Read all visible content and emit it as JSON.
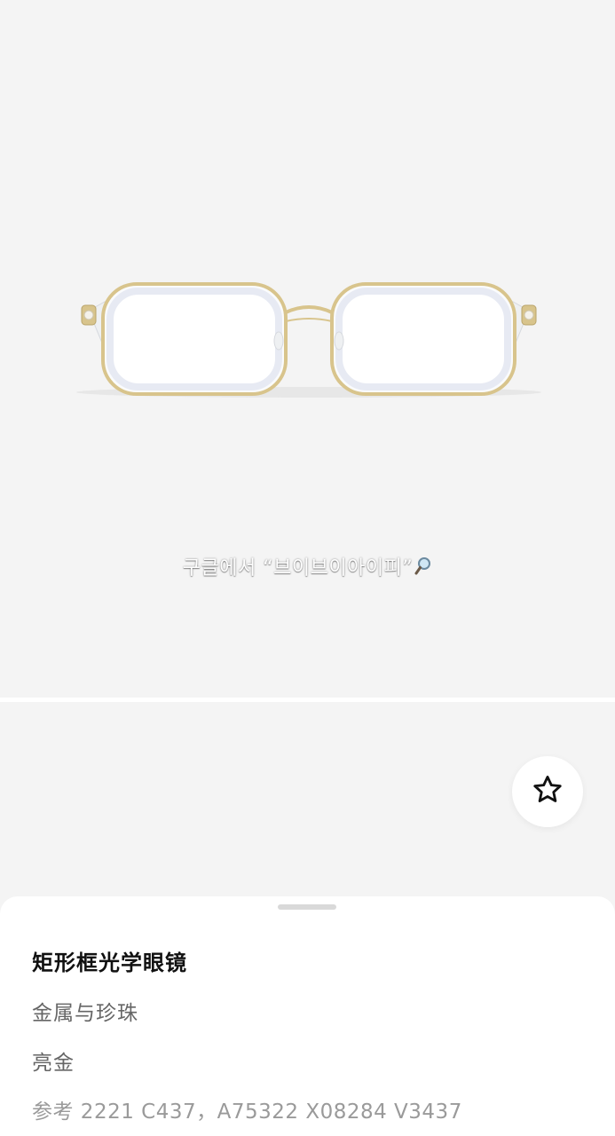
{
  "product": {
    "image_alt": "矩形框光学眼镜",
    "watermark_text": "구글에서 “브이브이아이피”",
    "favorite_icon": "star-outline-icon",
    "title": "矩形框光学眼镜",
    "material": "金属与珍珠",
    "color": "亮金",
    "reference": "参考 2221 C437，A75322 X08284 V3437"
  },
  "colors": {
    "frame_gold": "#d8c48c",
    "background": "#f4f4f4",
    "sheet": "#ffffff"
  }
}
